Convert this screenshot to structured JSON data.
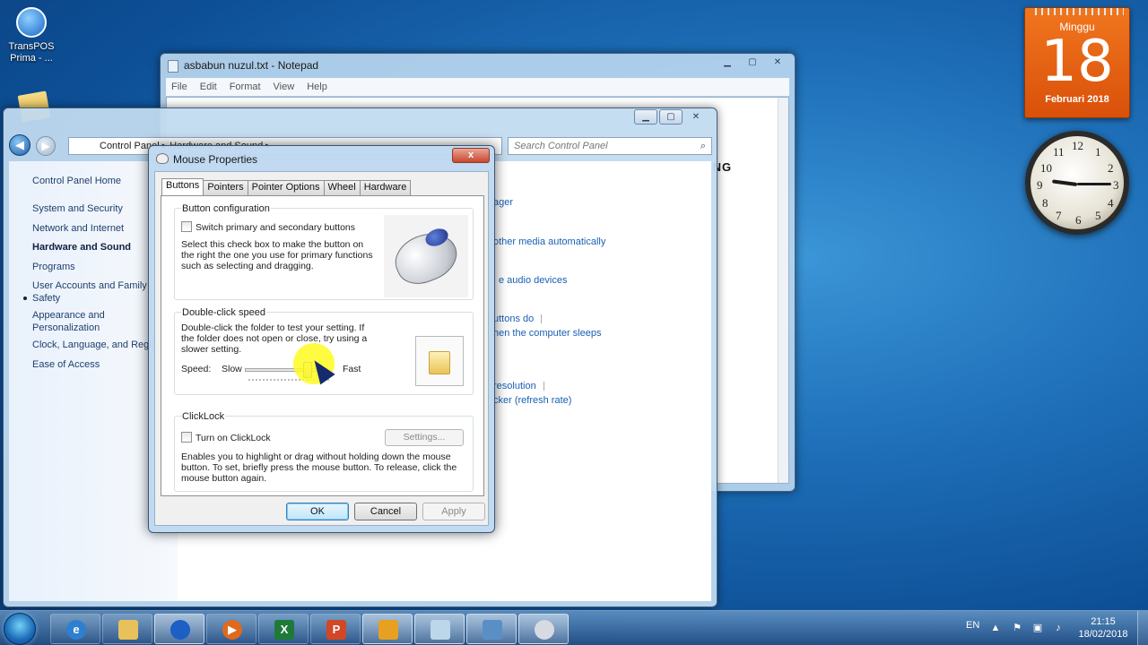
{
  "desktop": {
    "icon_label": "TransPOS Prima - ..."
  },
  "notepad": {
    "title": "asbabun nuzul.txt - Notepad",
    "menu": [
      "File",
      "Edit",
      "Format",
      "View",
      "Help"
    ],
    "visible_text": "ING"
  },
  "control_panel": {
    "address": "Control Panel  ▸  Hardware and Sound  ▸",
    "search_placeholder": "Search Control Panel",
    "left_nav": {
      "home": "Control Panel Home",
      "items": [
        "System and Security",
        "Network and Internet",
        "Hardware and Sound",
        "Programs",
        "User Accounts and Family Safety",
        "Appearance and Personalization",
        "Clock, Language, and Region",
        "Ease of Access"
      ]
    },
    "right_links": [
      "ager",
      "other media automatically",
      "e audio devices",
      "uttons do",
      "hen the computer sleeps",
      "resolution",
      "cker (refresh rate)"
    ]
  },
  "mouse_properties": {
    "title": "Mouse Properties",
    "close_label": "x",
    "tabs": [
      "Buttons",
      "Pointers",
      "Pointer Options",
      "Wheel",
      "Hardware"
    ],
    "button_config": {
      "title": "Button configuration",
      "checkbox_label": "Switch primary and secondary buttons",
      "checked": false,
      "description": "Select this check box to make the button on the right the one you use for primary functions such as selecting and dragging."
    },
    "double_click": {
      "title": "Double-click speed",
      "description": "Double-click the folder to test your setting. If the folder does not open or close, try using a slower setting.",
      "speed_label": "Speed:",
      "slow_label": "Slow",
      "fast_label": "Fast",
      "slider_fraction": 0.78
    },
    "clicklock": {
      "title": "ClickLock",
      "checkbox_label": "Turn on ClickLock",
      "checked": false,
      "settings_label": "Settings...",
      "description": "Enables you to highlight or drag without holding down the mouse button. To set, briefly press the mouse button. To release, click the mouse button again."
    },
    "buttons": {
      "ok": "OK",
      "cancel": "Cancel",
      "apply": "Apply"
    }
  },
  "calendar_gadget": {
    "day_name": "Minggu",
    "day_number": "18",
    "month_year": "Februari 2018"
  },
  "clock_gadget": {
    "numbers": [
      "12",
      "1",
      "2",
      "3",
      "4",
      "5",
      "6",
      "7",
      "8",
      "9",
      "10",
      "11"
    ],
    "time": "21:15"
  },
  "taskbar": {
    "apps": [
      "internet-explorer-icon",
      "file-explorer-icon",
      "transpos-icon",
      "media-player-icon",
      "excel-icon",
      "powerpoint-icon",
      "sticky-app-icon",
      "notepad-icon",
      "control-panel-icon",
      "mouse-icon"
    ],
    "language": "EN",
    "time": "21:15",
    "date": "18/02/2018"
  }
}
